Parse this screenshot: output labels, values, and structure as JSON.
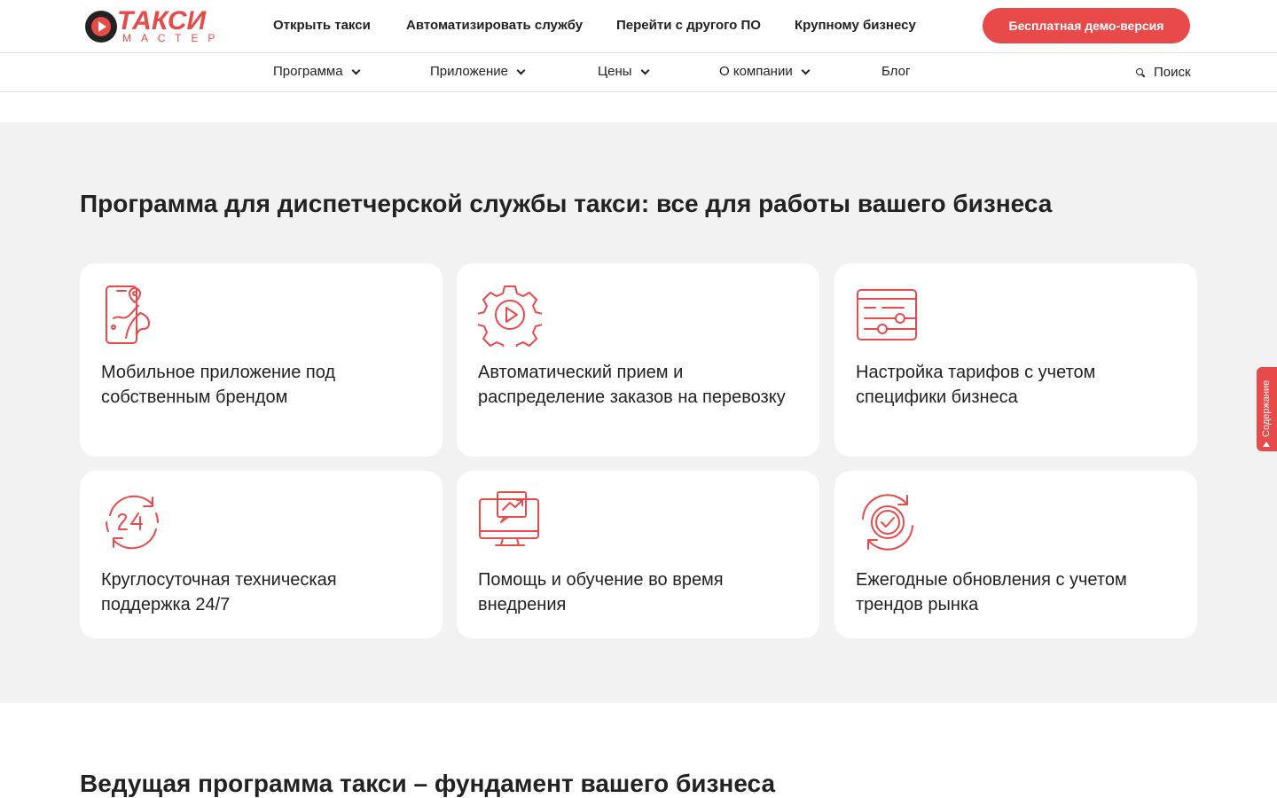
{
  "brand": {
    "name": "ТАКСИ",
    "subtitle": "МАСТЕР",
    "color": "#e84a4a"
  },
  "top_nav": {
    "links": [
      {
        "label": "Открыть такси"
      },
      {
        "label": "Автоматизировать службу"
      },
      {
        "label": "Перейти с другого ПО"
      },
      {
        "label": "Крупному бизнесу"
      }
    ],
    "demo_button": "Бесплатная демо-версия"
  },
  "main_nav": {
    "items": [
      {
        "label": "Программа",
        "has_dropdown": true
      },
      {
        "label": "Приложение",
        "has_dropdown": true
      },
      {
        "label": "Цены",
        "has_dropdown": true
      },
      {
        "label": "О компании",
        "has_dropdown": true
      },
      {
        "label": "Блог",
        "has_dropdown": false
      }
    ],
    "search_label": "Поиск"
  },
  "features": {
    "title": "Программа для диспетчерской службы такси: все для работы вашего бизнеса",
    "cards": [
      {
        "icon": "phone-map-pin-icon",
        "text": "Мобильное приложение под собственным брендом"
      },
      {
        "icon": "gear-play-icon",
        "text": "Автоматический прием и распределение заказов на перевозку"
      },
      {
        "icon": "tariff-sliders-icon",
        "text": "Настройка тарифов с учетом специфики бизнеса"
      },
      {
        "icon": "support-24-icon",
        "text": "Круглосуточная техническая поддержка 24/7"
      },
      {
        "icon": "monitor-chart-icon",
        "text": "Помощь и обучение во время внедрения"
      },
      {
        "icon": "update-check-icon",
        "text": "Ежегодные обновления с учетом трендов рынка"
      }
    ]
  },
  "side_tab": {
    "label": "Содержание"
  },
  "next_section": {
    "title": "Ведущая программа такси – фундамент вашего бизнеса"
  }
}
